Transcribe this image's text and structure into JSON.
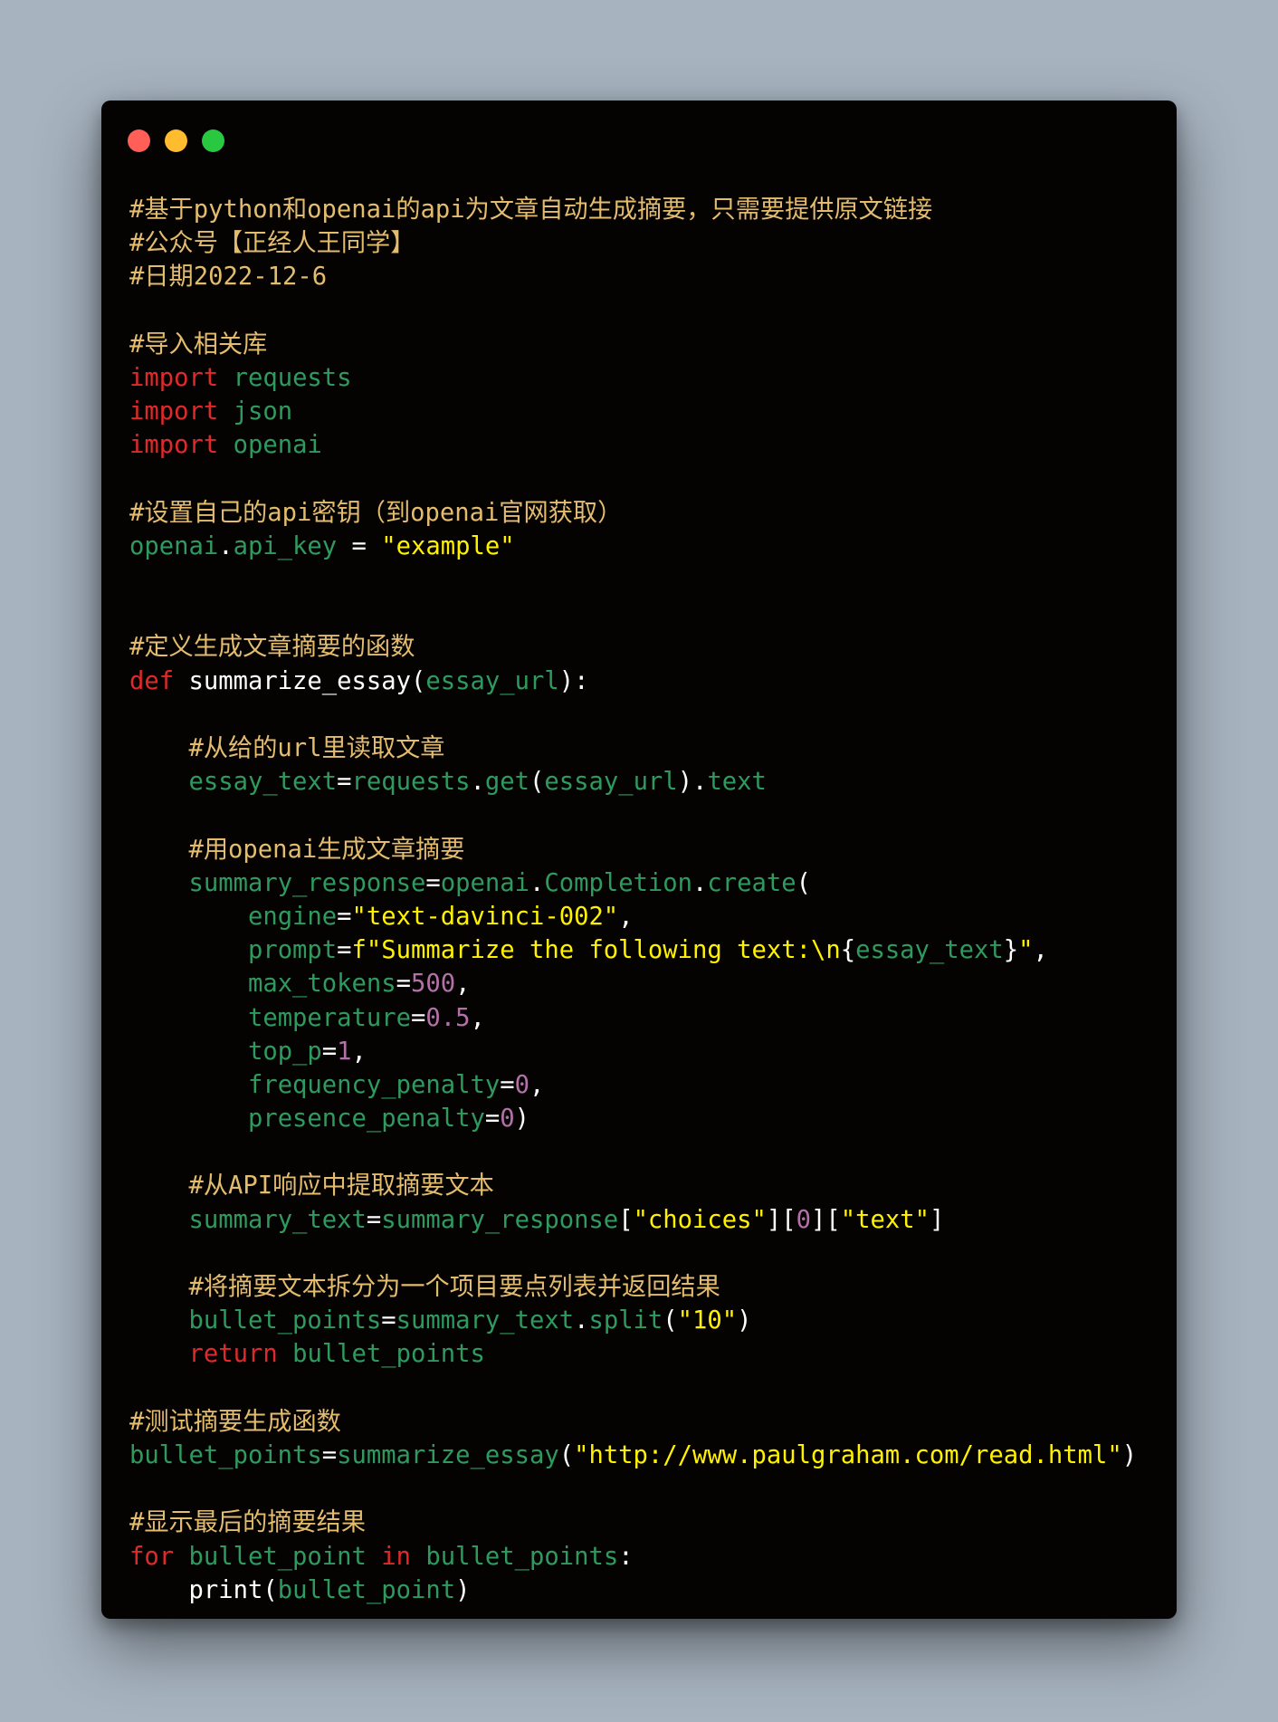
{
  "window": {
    "controls": [
      {
        "name": "close",
        "color": "#ff5f57"
      },
      {
        "name": "minimize",
        "color": "#febc2e"
      },
      {
        "name": "maximize",
        "color": "#28c840"
      }
    ]
  },
  "code_lines": [
    [
      {
        "t": "#基于python和openai的api为文章自动生成摘要，只需要提供原文链接",
        "k": "c"
      }
    ],
    [
      {
        "t": "#公众号【正经人王同学】",
        "k": "c"
      }
    ],
    [
      {
        "t": "#日期2022-12-6",
        "k": "c"
      }
    ],
    [],
    [
      {
        "t": "#导入相关库",
        "k": "c"
      }
    ],
    [
      {
        "t": "import",
        "k": "kw"
      },
      {
        "t": " ",
        "k": "p"
      },
      {
        "t": "requests",
        "k": "id"
      }
    ],
    [
      {
        "t": "import",
        "k": "kw"
      },
      {
        "t": " ",
        "k": "p"
      },
      {
        "t": "json",
        "k": "id"
      }
    ],
    [
      {
        "t": "import",
        "k": "kw"
      },
      {
        "t": " ",
        "k": "p"
      },
      {
        "t": "openai",
        "k": "id"
      }
    ],
    [],
    [
      {
        "t": "#设置自己的api密钥（到openai官网获取）",
        "k": "c"
      }
    ],
    [
      {
        "t": "openai",
        "k": "id"
      },
      {
        "t": ".",
        "k": "p"
      },
      {
        "t": "api_key",
        "k": "id"
      },
      {
        "t": " = ",
        "k": "p"
      },
      {
        "t": "\"example\"",
        "k": "str"
      }
    ],
    [],
    [],
    [
      {
        "t": "#定义生成文章摘要的函数",
        "k": "c"
      }
    ],
    [
      {
        "t": "def",
        "k": "kw"
      },
      {
        "t": " ",
        "k": "p"
      },
      {
        "t": "summarize_essay",
        "k": "fn"
      },
      {
        "t": "(",
        "k": "p"
      },
      {
        "t": "essay_url",
        "k": "id"
      },
      {
        "t": "):",
        "k": "p"
      }
    ],
    [],
    [
      {
        "t": "    ",
        "k": "p"
      },
      {
        "t": "#从给的url里读取文章",
        "k": "c"
      }
    ],
    [
      {
        "t": "    ",
        "k": "p"
      },
      {
        "t": "essay_text",
        "k": "id"
      },
      {
        "t": "=",
        "k": "p"
      },
      {
        "t": "requests",
        "k": "id"
      },
      {
        "t": ".",
        "k": "p"
      },
      {
        "t": "get",
        "k": "id"
      },
      {
        "t": "(",
        "k": "p"
      },
      {
        "t": "essay_url",
        "k": "id"
      },
      {
        "t": ").",
        "k": "p"
      },
      {
        "t": "text",
        "k": "id"
      }
    ],
    [],
    [
      {
        "t": "    ",
        "k": "p"
      },
      {
        "t": "#用openai生成文章摘要",
        "k": "c"
      }
    ],
    [
      {
        "t": "    ",
        "k": "p"
      },
      {
        "t": "summary_response",
        "k": "id"
      },
      {
        "t": "=",
        "k": "p"
      },
      {
        "t": "openai",
        "k": "id"
      },
      {
        "t": ".",
        "k": "p"
      },
      {
        "t": "Completion",
        "k": "id"
      },
      {
        "t": ".",
        "k": "p"
      },
      {
        "t": "create",
        "k": "id"
      },
      {
        "t": "(",
        "k": "p"
      }
    ],
    [
      {
        "t": "        ",
        "k": "p"
      },
      {
        "t": "engine",
        "k": "id"
      },
      {
        "t": "=",
        "k": "p"
      },
      {
        "t": "\"text-davinci-002\"",
        "k": "str"
      },
      {
        "t": ",",
        "k": "p"
      }
    ],
    [
      {
        "t": "        ",
        "k": "p"
      },
      {
        "t": "prompt",
        "k": "id"
      },
      {
        "t": "=",
        "k": "p"
      },
      {
        "t": "f\"Summarize the following text:\\n",
        "k": "str"
      },
      {
        "t": "{",
        "k": "p"
      },
      {
        "t": "essay_text",
        "k": "id"
      },
      {
        "t": "}",
        "k": "p"
      },
      {
        "t": "\"",
        "k": "str"
      },
      {
        "t": ",",
        "k": "p"
      }
    ],
    [
      {
        "t": "        ",
        "k": "p"
      },
      {
        "t": "max_tokens",
        "k": "id"
      },
      {
        "t": "=",
        "k": "p"
      },
      {
        "t": "500",
        "k": "num"
      },
      {
        "t": ",",
        "k": "p"
      }
    ],
    [
      {
        "t": "        ",
        "k": "p"
      },
      {
        "t": "temperature",
        "k": "id"
      },
      {
        "t": "=",
        "k": "p"
      },
      {
        "t": "0.5",
        "k": "num"
      },
      {
        "t": ",",
        "k": "p"
      }
    ],
    [
      {
        "t": "        ",
        "k": "p"
      },
      {
        "t": "top_p",
        "k": "id"
      },
      {
        "t": "=",
        "k": "p"
      },
      {
        "t": "1",
        "k": "num"
      },
      {
        "t": ",",
        "k": "p"
      }
    ],
    [
      {
        "t": "        ",
        "k": "p"
      },
      {
        "t": "frequency_penalty",
        "k": "id"
      },
      {
        "t": "=",
        "k": "p"
      },
      {
        "t": "0",
        "k": "num"
      },
      {
        "t": ",",
        "k": "p"
      }
    ],
    [
      {
        "t": "        ",
        "k": "p"
      },
      {
        "t": "presence_penalty",
        "k": "id"
      },
      {
        "t": "=",
        "k": "p"
      },
      {
        "t": "0",
        "k": "num"
      },
      {
        "t": ")",
        "k": "p"
      }
    ],
    [],
    [
      {
        "t": "    ",
        "k": "p"
      },
      {
        "t": "#从API响应中提取摘要文本",
        "k": "c"
      }
    ],
    [
      {
        "t": "    ",
        "k": "p"
      },
      {
        "t": "summary_text",
        "k": "id"
      },
      {
        "t": "=",
        "k": "p"
      },
      {
        "t": "summary_response",
        "k": "id"
      },
      {
        "t": "[",
        "k": "p"
      },
      {
        "t": "\"choices\"",
        "k": "str"
      },
      {
        "t": "][",
        "k": "p"
      },
      {
        "t": "0",
        "k": "num"
      },
      {
        "t": "][",
        "k": "p"
      },
      {
        "t": "\"text\"",
        "k": "str"
      },
      {
        "t": "]",
        "k": "p"
      }
    ],
    [],
    [
      {
        "t": "    ",
        "k": "p"
      },
      {
        "t": "#将摘要文本拆分为一个项目要点列表并返回结果",
        "k": "c"
      }
    ],
    [
      {
        "t": "    ",
        "k": "p"
      },
      {
        "t": "bullet_points",
        "k": "id"
      },
      {
        "t": "=",
        "k": "p"
      },
      {
        "t": "summary_text",
        "k": "id"
      },
      {
        "t": ".",
        "k": "p"
      },
      {
        "t": "split",
        "k": "id"
      },
      {
        "t": "(",
        "k": "p"
      },
      {
        "t": "\"10\"",
        "k": "str"
      },
      {
        "t": ")",
        "k": "p"
      }
    ],
    [
      {
        "t": "    ",
        "k": "p"
      },
      {
        "t": "return",
        "k": "kw"
      },
      {
        "t": " ",
        "k": "p"
      },
      {
        "t": "bullet_points",
        "k": "id"
      }
    ],
    [],
    [
      {
        "t": "#测试摘要生成函数",
        "k": "c"
      }
    ],
    [
      {
        "t": "bullet_points",
        "k": "id"
      },
      {
        "t": "=",
        "k": "p"
      },
      {
        "t": "summarize_essay",
        "k": "id"
      },
      {
        "t": "(",
        "k": "p"
      },
      {
        "t": "\"http://www.paulgraham.com/read.html\"",
        "k": "str"
      },
      {
        "t": ")",
        "k": "p"
      }
    ],
    [],
    [
      {
        "t": "#显示最后的摘要结果",
        "k": "c"
      }
    ],
    [
      {
        "t": "for",
        "k": "kw"
      },
      {
        "t": " ",
        "k": "p"
      },
      {
        "t": "bullet_point",
        "k": "id"
      },
      {
        "t": " ",
        "k": "p"
      },
      {
        "t": "in",
        "k": "kw"
      },
      {
        "t": " ",
        "k": "p"
      },
      {
        "t": "bullet_points",
        "k": "id"
      },
      {
        "t": ":",
        "k": "p"
      }
    ],
    [
      {
        "t": "    ",
        "k": "p"
      },
      {
        "t": "print",
        "k": "fn"
      },
      {
        "t": "(",
        "k": "p"
      },
      {
        "t": "bullet_point",
        "k": "id"
      },
      {
        "t": ")",
        "k": "p"
      }
    ]
  ]
}
